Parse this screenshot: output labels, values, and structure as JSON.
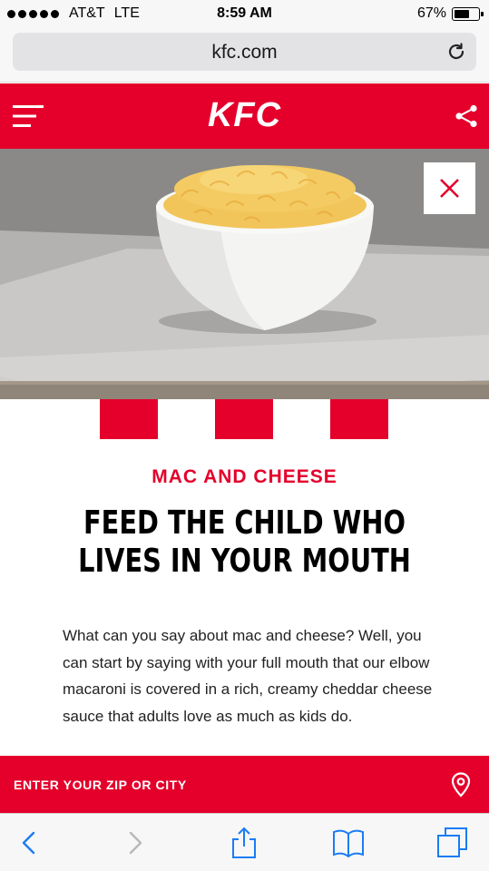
{
  "status_bar": {
    "carrier": "AT&T",
    "network": "LTE",
    "time": "8:59 AM",
    "battery_percent": "67%",
    "battery_level": 0.67
  },
  "browser": {
    "url": "kfc.com",
    "reload_icon": "reload-icon"
  },
  "header": {
    "logo": "KFC",
    "brand_color": "#e4002b",
    "menu_icon": "hamburger-menu-icon",
    "share_icon": "share-icon"
  },
  "hero": {
    "close_icon": "close-icon"
  },
  "content": {
    "eyebrow": "MAC AND CHEESE",
    "headline_line1": "FEED THE CHILD WHO",
    "headline_line2": "LIVES IN YOUR MOUTH",
    "body": "What can you say about mac and cheese? Well, you can start by saying with your full mouth that our elbow macaroni is covered in a rich, creamy cheddar cheese sauce that adults love as much as kids do."
  },
  "zip_bar": {
    "label": "ENTER YOUR ZIP OR CITY",
    "icon": "location-pin-icon"
  },
  "toolbar": {
    "icons": [
      "back-icon",
      "forward-icon",
      "share-icon",
      "bookmarks-icon",
      "tabs-icon"
    ]
  }
}
